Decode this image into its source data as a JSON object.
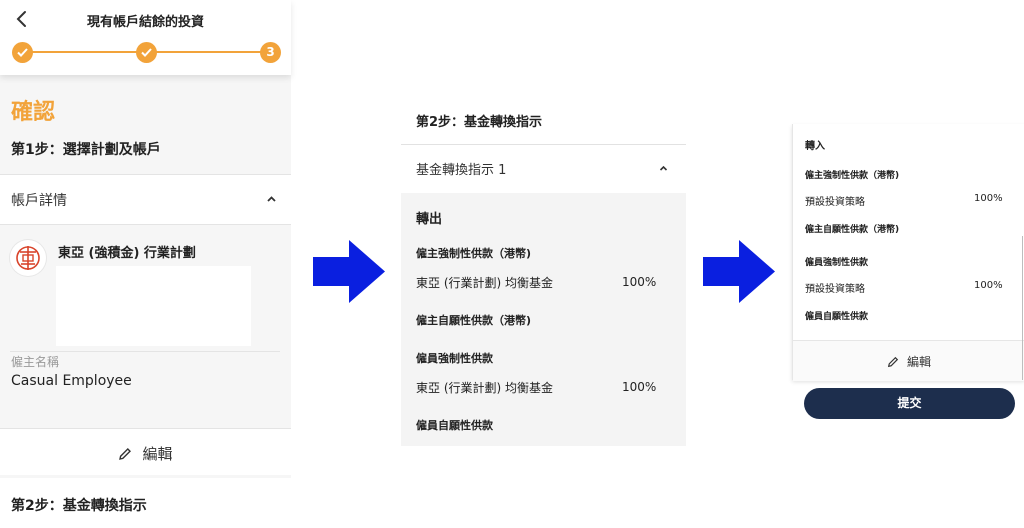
{
  "panel1": {
    "header_title": "現有帳戶結餘的投資",
    "current_step": "3",
    "confirm_title": "確認",
    "step1_title": "第1步：選擇計劃及帳戶",
    "account_details_label": "帳戶詳情",
    "plan_name": "東亞 (強積金) 行業計劃",
    "employer_name_label": "僱主名稱",
    "employer_name_value": "Casual Employee",
    "edit_label": "編輯",
    "step2_title": "第2步：基金轉換指示"
  },
  "panel2": {
    "step2_title": "第2步：基金轉換指示",
    "instruction_label": "基金轉換指示 1",
    "transfer_out_label": "轉出",
    "rows": [
      {
        "category": "僱主強制性供款（港幣)",
        "fund": "東亞 (行業計劃) 均衡基金",
        "percent": "100%"
      },
      {
        "category": "僱主自願性供款（港幣)"
      },
      {
        "category": "僱員強制性供款",
        "fund": "東亞 (行業計劃) 均衡基金",
        "percent": "100%"
      },
      {
        "category": "僱員自願性供款"
      }
    ]
  },
  "panel3": {
    "transfer_in_label": "轉入",
    "rows": [
      {
        "category": "僱主強制性供款（港幣)",
        "fund": "預設投資策略",
        "percent": "100%"
      },
      {
        "category": "僱主自願性供款（港幣)"
      },
      {
        "category": "僱員強制性供款",
        "fund": "預設投資策略",
        "percent": "100%"
      },
      {
        "category": "僱員自願性供款"
      }
    ],
    "edit_label": "編輯",
    "submit_label": "提交"
  },
  "colors": {
    "accent": "#f2a33a",
    "navy": "#1d2e4d",
    "arrow_blue": "#0a1fe0"
  },
  "icons": [
    "chevron-left-icon",
    "check-icon",
    "chevron-up-icon",
    "pencil-icon",
    "bea-logo",
    "right-arrow"
  ]
}
